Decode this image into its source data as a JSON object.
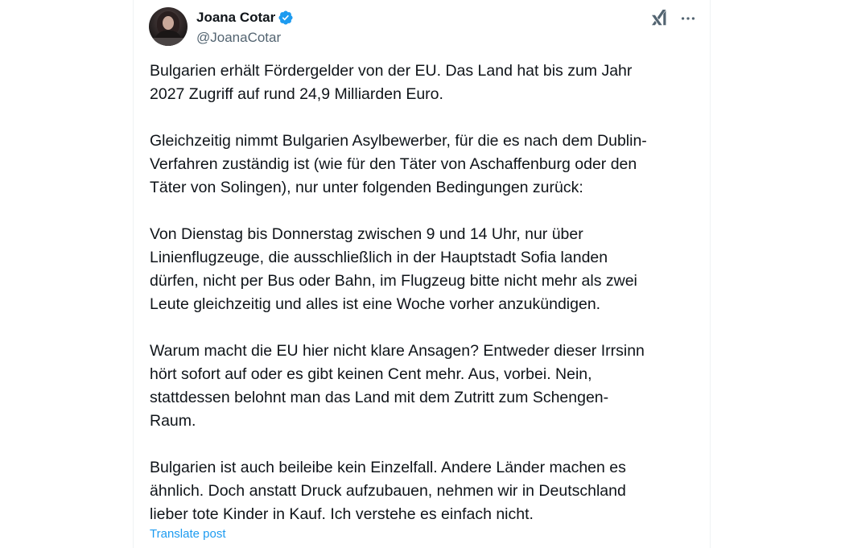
{
  "tweet": {
    "author": {
      "display_name": "Joana Cotar",
      "handle": "@JoanaCotar",
      "verified": true,
      "avatar_icon": "profile-photo"
    },
    "actions": {
      "grok_icon": "grok-icon",
      "more_icon": "more-options-icon"
    },
    "paragraphs": [
      "Bulgarien erhält Fördergelder von der EU. Das Land hat bis zum Jahr\n2027 Zugriff auf rund 24,9 Milliarden Euro.",
      "Gleichzeitig nimmt Bulgarien Asylbewerber, für die es nach dem Dublin-\nVerfahren zuständig ist (wie für den Täter von Aschaffenburg oder den\nTäter von Solingen), nur unter folgenden Bedingungen zurück:",
      "Von Dienstag bis Donnerstag zwischen 9 und 14 Uhr, nur über\nLinienflugzeuge, die ausschließlich in der Hauptstadt Sofia landen\ndürfen, nicht per Bus oder Bahn, im Flugzeug bitte nicht mehr als zwei\nLeute gleichzeitig und alles ist eine Woche vorher anzukündigen.",
      "Warum macht die EU hier nicht klare Ansagen? Entweder dieser Irrsinn\nhört sofort auf oder es gibt keinen Cent mehr. Aus, vorbei. Nein,\nstattdessen belohnt man das Land mit dem Zutritt zum Schengen-\nRaum.",
      "Bulgarien ist auch beileibe kein Einzelfall. Andere Länder machen es\nähnlich. Doch anstatt Druck aufzubauen, nehmen wir in Deutschland\nlieber tote Kinder in Kauf. Ich verstehe es einfach nicht."
    ],
    "translate_label": "Translate post"
  },
  "colors": {
    "text": "#0f1419",
    "secondary_text": "#536471",
    "link": "#1d9bf0",
    "verified_badge": "#1d9bf0",
    "border": "#eff3f4"
  }
}
